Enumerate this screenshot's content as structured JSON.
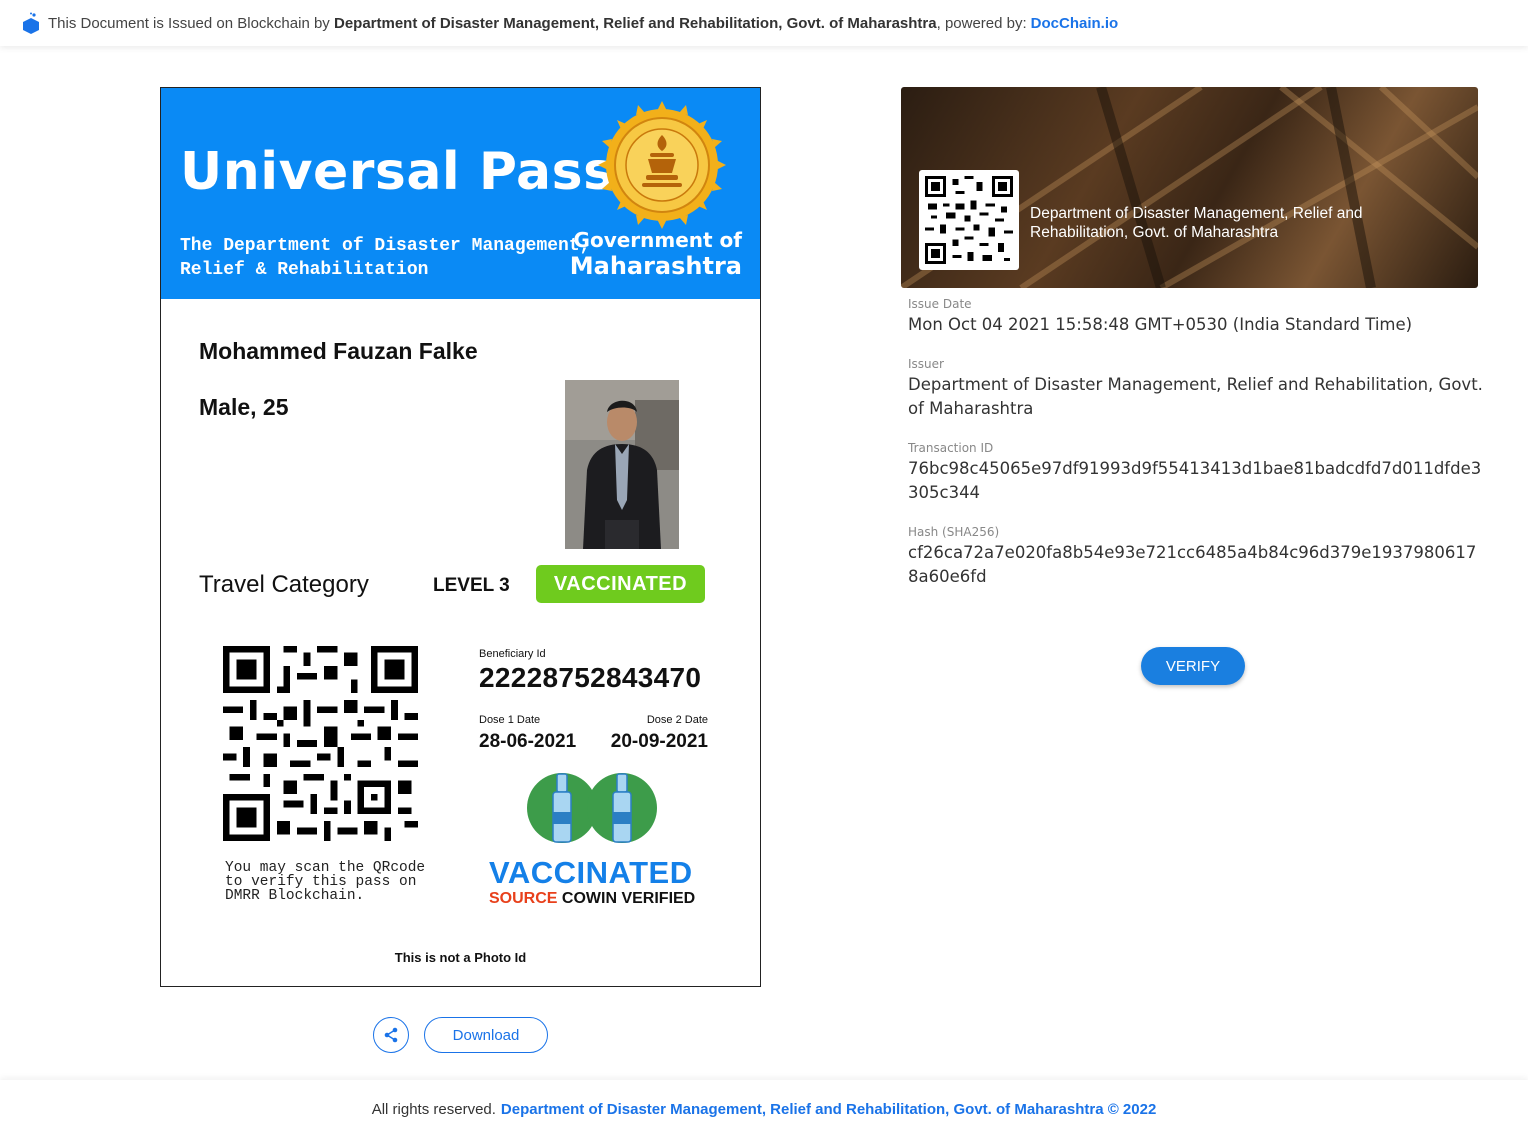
{
  "banner": {
    "prefix": "This Document is Issued on Blockchain by",
    "issuer": "Department of Disaster Management, Relief and Rehabilitation, Govt. of Maharashtra",
    "powered_by": ", powered by:",
    "brand": "DocChain.io"
  },
  "pass": {
    "title": "Universal Pass",
    "department": "The Department of Disaster Management, Relief & Rehabilitation",
    "gov_line1": "Government of",
    "gov_line2": "Maharashtra",
    "name": "Mohammed Fauzan Falke",
    "gender_age": "Male, 25",
    "travel_category_label": "Travel Category",
    "level": "LEVEL 3",
    "status_badge": "VACCINATED",
    "scan_note": "You may scan the QRcode to  verify this pass on DMRR Blockchain.",
    "beneficiary_label": "Beneficiary Id",
    "beneficiary_id": "22228752843470",
    "dose1_label": "Dose 1 Date",
    "dose2_label": "Dose 2 Date",
    "dose1_date": "28-06-2021",
    "dose2_date": "20-09-2021",
    "vaccinated_big": "VACCINATED",
    "source_word": "SOURCE",
    "source_rest": " COWIN VERIFIED",
    "not_photo_id": "This is not a Photo Id"
  },
  "actions": {
    "share_icon": "share-icon",
    "download_label": "Download"
  },
  "issuer_panel": {
    "name": "Department of Disaster Management, Relief and Rehabilitation, Govt. of Maharashtra"
  },
  "details": {
    "issue_date_label": "Issue Date",
    "issue_date": "Mon Oct 04 2021 15:58:48 GMT+0530 (India Standard Time)",
    "issuer_label": "Issuer",
    "issuer": "Department of Disaster Management, Relief and Rehabilitation, Govt. of Maharashtra",
    "tx_label": "Transaction ID",
    "tx": "76bc98c45065e97df91993d9f55413413d1bae81badcdfd7d011dfde3305c344",
    "hash_label": "Hash (SHA256)",
    "hash": "cf26ca72a7e020fa8b54e93e721cc6485a4b84c96d379e19379806178a60e6fd"
  },
  "verify_label": "VERIFY",
  "footer": {
    "prefix": "All rights reserved.",
    "org": "Department of Disaster Management, Relief and Rehabilitation, Govt. of Maharashtra © 2022"
  },
  "colors": {
    "brand_blue": "#1a73e8",
    "pass_header": "#0a8af5",
    "vaccinated_green": "#6fcb1e"
  }
}
